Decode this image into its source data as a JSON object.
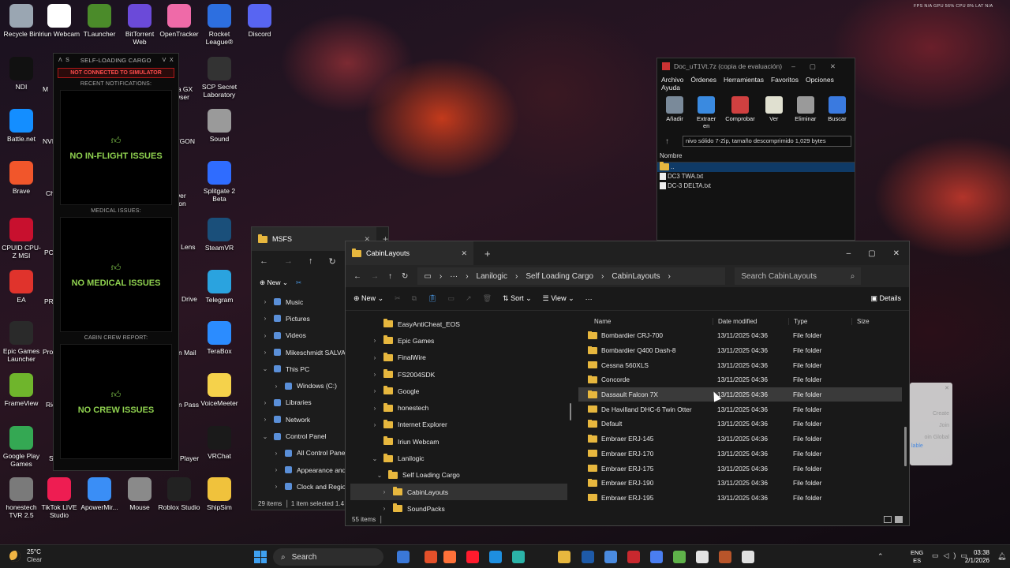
{
  "desktop": {
    "icons": [
      {
        "label": "Recycle Bin",
        "color": "#9aa6b2"
      },
      {
        "label": "Iriun Webcam",
        "color": "#ffffff"
      },
      {
        "label": "TLauncher",
        "color": "#4b8b2a"
      },
      {
        "label": "BitTorrent Web",
        "color": "#6b4ad9"
      },
      {
        "label": "OpenTracker",
        "color": "#ef6aa8"
      },
      {
        "label": "Rocket League®",
        "color": "#2d6fe0"
      },
      {
        "label": "Discord",
        "color": "#5865f2"
      },
      {
        "label": "NDI",
        "color": "#111111"
      },
      {
        "label": "Battle.net",
        "color": "#148eff"
      },
      {
        "label": "Brave",
        "color": "#f1562b"
      },
      {
        "label": "CPUID CPU-Z MSI",
        "color": "#c8102e"
      },
      {
        "label": "EA",
        "color": "#e0332c"
      },
      {
        "label": "Epic Games Launcher",
        "color": "#2a2a2a"
      },
      {
        "label": "FrameView",
        "color": "#6fb52c"
      },
      {
        "label": "Google Play Games",
        "color": "#34a853"
      },
      {
        "label": "honestech TVR 2.5",
        "color": "#7a7a7a"
      },
      {
        "label": "TikTok LIVE Studio",
        "color": "#ee1d52"
      },
      {
        "label": "ApowerMir...",
        "color": "#3a8ef6"
      },
      {
        "label": "Mouse",
        "color": "#8a8a8a"
      },
      {
        "label": "Roblox Studio",
        "color": "#222222"
      },
      {
        "label": "ShipSim",
        "color": "#f0c23c"
      },
      {
        "label": "SCP Secret Laboratory",
        "color": "#333333"
      },
      {
        "label": "Sound",
        "color": "#9a9a9a"
      },
      {
        "label": "Splitgate 2 Beta",
        "color": "#2f6cff"
      },
      {
        "label": "SteamVR",
        "color": "#1a4f7a"
      },
      {
        "label": "Telegram",
        "color": "#2aa3df"
      },
      {
        "label": "TeraBox",
        "color": "#2b8cff"
      },
      {
        "label": "VoiceMeeter",
        "color": "#f5d24b"
      },
      {
        "label": "VRChat",
        "color": "#1a1a1a"
      }
    ],
    "partial_labels": [
      "M",
      "ra GX",
      "wser",
      "YGON",
      "wer",
      "tion",
      "1 Lens",
      "Drive",
      "n Mail",
      "n Pass",
      "Player",
      "NVI",
      "Ch",
      "PC",
      "PR",
      "Pro",
      "Ric",
      "S"
    ]
  },
  "slc": {
    "title": "SELF-LOADING CARGO",
    "controls": [
      "Λ",
      "S",
      "V",
      "X"
    ],
    "status": "NOT CONNECTED TO SIMULATOR",
    "sections": [
      {
        "heading": "RECENT NOTIFICATIONS:",
        "message": "NO IN-FLIGHT ISSUES"
      },
      {
        "heading": "MEDICAL ISSUES:",
        "message": "NO MEDICAL ISSUES"
      },
      {
        "heading": "CABIN CREW REPORT:",
        "message": "NO CREW ISSUES"
      }
    ]
  },
  "zip": {
    "title": "Doc_uT1Vt.7z (copia de evaluación)",
    "menu": [
      "Archivo",
      "Órdenes",
      "Herramientas",
      "Favoritos",
      "Opciones",
      "Ayuda"
    ],
    "tools": [
      {
        "label": "Añadir",
        "color": "#7a8a9a"
      },
      {
        "label": "Extraer en",
        "color": "#3a8ae0"
      },
      {
        "label": "Comprobar",
        "color": "#d04040"
      },
      {
        "label": "Ver",
        "color": "#e0e0d0"
      },
      {
        "label": "Eliminar",
        "color": "#9a9a9a"
      },
      {
        "label": "Buscar",
        "color": "#3a7ae0"
      }
    ],
    "path": "nivo sólido 7-Zip, tamaño descomprimido 1,029 bytes",
    "column": "Nombre",
    "rows": [
      "..",
      "DC3 TWA.txt",
      "DC-3 DELTA.txt"
    ]
  },
  "msfs": {
    "tab": "MSFS",
    "new_label": "New",
    "nav": [
      "Music",
      "Pictures",
      "Videos",
      "Mikeschmidt SALVATO",
      "This PC",
      "Windows (C:)",
      "Libraries",
      "Network",
      "Control Panel",
      "All Control Panel Item",
      "Appearance and Pers",
      "Clock and Region"
    ],
    "status": "29 items",
    "status_selected": "1 item selected 1.4"
  },
  "explorer": {
    "tab": "CabinLayouts",
    "breadcrumb": [
      "Lanilogic",
      "Self Loading Cargo",
      "CabinLayouts"
    ],
    "search_placeholder": "Search CabinLayouts",
    "cmd": {
      "new": "New",
      "sort": "Sort",
      "view": "View",
      "details": "Details"
    },
    "nav": [
      {
        "label": "EasyAntiCheat_EOS",
        "indent": 1,
        "chev": ""
      },
      {
        "label": "Epic Games",
        "indent": 1,
        "chev": "›"
      },
      {
        "label": "FinalWire",
        "indent": 1,
        "chev": "›"
      },
      {
        "label": "FS2004SDK",
        "indent": 1,
        "chev": "›"
      },
      {
        "label": "Google",
        "indent": 1,
        "chev": "›"
      },
      {
        "label": "honestech",
        "indent": 1,
        "chev": "›"
      },
      {
        "label": "Internet Explorer",
        "indent": 1,
        "chev": "›"
      },
      {
        "label": "Iriun Webcam",
        "indent": 1,
        "chev": ""
      },
      {
        "label": "Lanilogic",
        "indent": 1,
        "chev": "⌄"
      },
      {
        "label": "Self Loading Cargo",
        "indent": 2,
        "chev": "⌄"
      },
      {
        "label": "CabinLayouts",
        "indent": 3,
        "chev": "›",
        "selected": true
      },
      {
        "label": "SoundPacks",
        "indent": 3,
        "chev": "›"
      }
    ],
    "columns": [
      "Name",
      "Date modified",
      "Type",
      "Size"
    ],
    "files": [
      {
        "name": "Bombardier CRJ-700",
        "date": "13/11/2025 04:36",
        "type": "File folder"
      },
      {
        "name": "Bombardier Q400 Dash-8",
        "date": "13/11/2025 04:36",
        "type": "File folder"
      },
      {
        "name": "Cessna 560XLS",
        "date": "13/11/2025 04:36",
        "type": "File folder"
      },
      {
        "name": "Concorde",
        "date": "13/11/2025 04:36",
        "type": "File folder"
      },
      {
        "name": "Dassault Falcon 7X",
        "date": "13/11/2025 04:36",
        "type": "File folder",
        "hover": true
      },
      {
        "name": "De Havilland DHC-6 Twin Otter",
        "date": "13/11/2025 04:36",
        "type": "File folder"
      },
      {
        "name": "Default",
        "date": "13/11/2025 04:36",
        "type": "File folder"
      },
      {
        "name": "Embraer ERJ-145",
        "date": "13/11/2025 04:36",
        "type": "File folder"
      },
      {
        "name": "Embraer ERJ-170",
        "date": "13/11/2025 04:36",
        "type": "File folder"
      },
      {
        "name": "Embraer ERJ-175",
        "date": "13/11/2025 04:36",
        "type": "File folder"
      },
      {
        "name": "Embraer ERJ-190",
        "date": "13/11/2025 04:36",
        "type": "File folder"
      },
      {
        "name": "Embraer ERJ-195",
        "date": "13/11/2025 04:36",
        "type": "File folder"
      }
    ],
    "status": "55 items"
  },
  "ghost_popup": [
    "Create",
    "Join",
    "oin Global",
    "lable"
  ],
  "overlay_stats": "FPS N/A   GPU 56%   CPU 8%   LAT N/A",
  "taskbar": {
    "weather_temp": "25°C",
    "weather_desc": "Clear",
    "search_label": "Search",
    "lang_top": "ENG",
    "lang_bottom": "ES",
    "time": "03:38",
    "date": "2/1/2026",
    "apps": [
      "#3a78d8",
      "#e4502a",
      "#ff7139",
      "#ff1b2d",
      "#1e8fe0",
      "#2bb3a8",
      "#e7b73e",
      "#1e5aa8",
      "#4a8adf",
      "#c8282e",
      "#4a7ef0",
      "#5fb24a",
      "#e3e3e3",
      "#b8552a",
      "#e0e0e0"
    ]
  }
}
